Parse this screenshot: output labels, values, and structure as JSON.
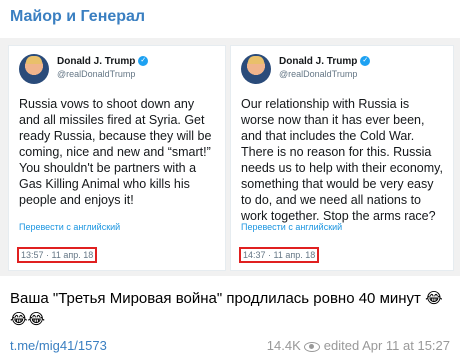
{
  "channel_name": "Майор и Генерал",
  "tweets": [
    {
      "author": "Donald J. Trump",
      "handle": "@realDonaldTrump",
      "text": "Russia vows to shoot down any and all missiles fired at Syria. Get ready Russia, because they will be coming, nice and new and “smart!” You shouldn't be partners with a Gas Killing Animal who kills his people and enjoys it!",
      "translate": "Перевести с английский",
      "timestamp": "13:57 · 11 апр. 18"
    },
    {
      "author": "Donald J. Trump",
      "handle": "@realDonaldTrump",
      "text": "Our relationship with Russia is worse now than it has ever been, and that includes the Cold War. There is no reason for this. Russia needs us to help with their economy, something that would be very easy to do, and we need all nations to work together. Stop the arms race?",
      "translate": "Перевести с английский",
      "timestamp": "14:37 · 11 апр. 18"
    }
  ],
  "caption": "Ваша \"Третья Мировая война\" продлилась ровно 40 минут 😂😂😂",
  "post_link": "t.me/mig41/1573",
  "views": "14.4K",
  "edited": "edited Apr 11 at 15:27",
  "icons": {
    "views": "eye-icon",
    "verified": "verified-icon",
    "avatar": "avatar"
  },
  "colors": {
    "accent": "#3a7fc1",
    "highlight": "#e02020",
    "tweet_link": "#1b95e0"
  }
}
